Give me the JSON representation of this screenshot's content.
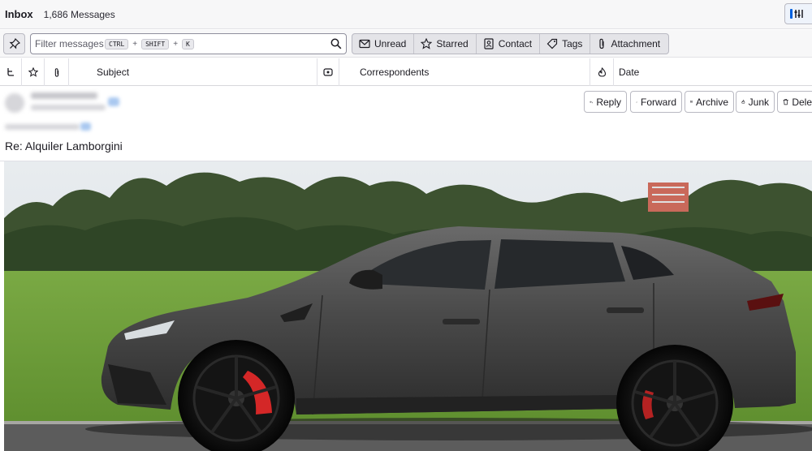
{
  "folder": {
    "name": "Inbox",
    "count": "1,686 Messages"
  },
  "filter": {
    "placeholder": "Filter messages…",
    "shortcut": [
      "CTRL",
      "SHIFT",
      "K"
    ],
    "plus": "+"
  },
  "quick_filters": [
    "Unread",
    "Starred",
    "Contact",
    "Tags",
    "Attachment"
  ],
  "columns": {
    "subject": "Subject",
    "correspondents": "Correspondents",
    "date": "Date"
  },
  "actions": {
    "reply": "Reply",
    "forward": "Forward",
    "archive": "Archive",
    "junk": "Junk",
    "delete": "Dele"
  },
  "message": {
    "subject": "Re: Alquiler Lamborgini"
  },
  "colors": {
    "accent": "#0061e0",
    "toolbar_bg": "#f7f7f8",
    "border": "#b9b9c2",
    "car_body": "#4a4a4a",
    "brake_caliper": "#d42727",
    "grass": "#6fa03a"
  }
}
